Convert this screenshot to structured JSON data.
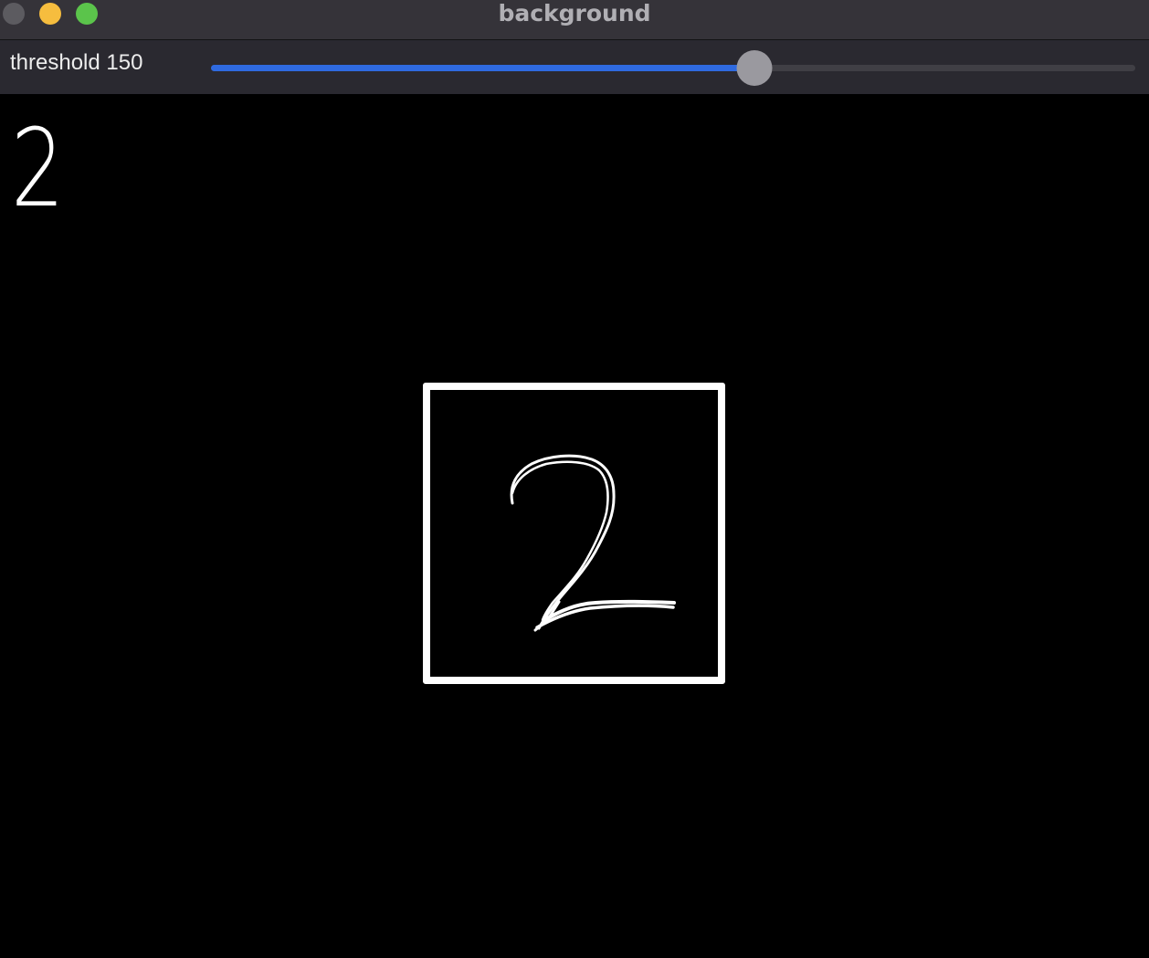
{
  "window": {
    "title": "background"
  },
  "toolbar": {
    "slider_label": "threshold 150",
    "slider": {
      "name": "threshold",
      "value": 150,
      "min": 0,
      "max": 255,
      "accent_color": "#2f6ae0"
    }
  },
  "canvas": {
    "prediction_text": "2",
    "drawn_digit": "handwritten-digit-2",
    "bounding_box": "white-rectangle"
  },
  "colors": {
    "titlebar": "#353339",
    "toolbar": "#2a2930",
    "canvas": "#000000",
    "close_button": "#5c5b60",
    "minimize_button": "#f6bd3e",
    "zoom_button": "#5bc44b"
  }
}
